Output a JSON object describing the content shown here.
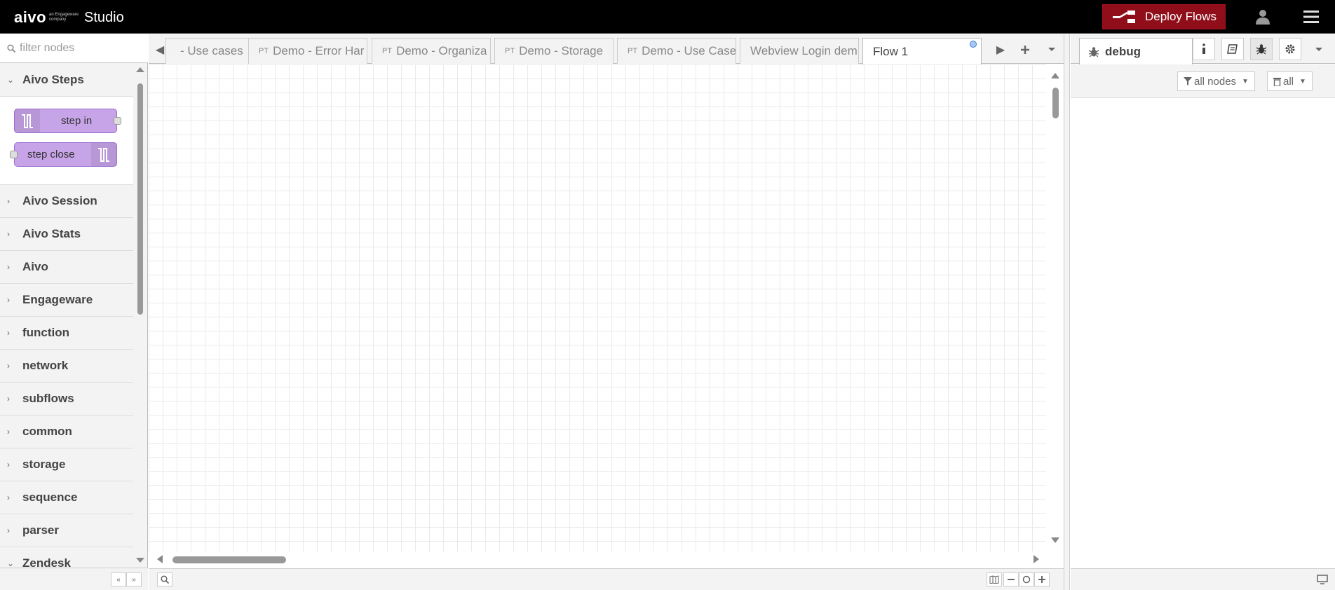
{
  "header": {
    "logo_text": "aivo",
    "logo_tagline": "an Engageware company",
    "app_name": "Studio",
    "deploy_label": "Deploy Flows",
    "icons": [
      "deploy-icon",
      "user-icon",
      "menu-icon"
    ]
  },
  "palette": {
    "filter_placeholder": "filter nodes",
    "open_category": {
      "label": "Aivo Steps",
      "nodes": [
        {
          "label": "step in",
          "icon": "step-icon"
        },
        {
          "label": "step close",
          "icon": "step-icon"
        }
      ]
    },
    "categories": [
      "Aivo Session",
      "Aivo Stats",
      "Aivo",
      "Engageware",
      "function",
      "network",
      "subflows",
      "common",
      "storage",
      "sequence",
      "parser"
    ],
    "last_category": "Zendesk",
    "node_color": "#c7a4e8"
  },
  "workspace": {
    "tabs": [
      {
        "prefix": "",
        "label": "- Use cases"
      },
      {
        "prefix": "PT",
        "label": "Demo - Error Har"
      },
      {
        "prefix": "PT",
        "label": "Demo - Organiza"
      },
      {
        "prefix": "PT",
        "label": "Demo - Storage"
      },
      {
        "prefix": "PT",
        "label": "Demo - Use Case"
      },
      {
        "prefix": "",
        "label": "Webview Login dem"
      },
      {
        "prefix": "",
        "label": "Flow 1"
      }
    ],
    "active_tab": "Flow 1",
    "tab_controls": [
      "scroll-left-icon",
      "scroll-right-icon",
      "add-icon",
      "tab-menu-icon"
    ],
    "footer_icons": [
      "search-icon",
      "navigator-icon",
      "zoom-out-icon",
      "zoom-reset-icon",
      "zoom-in-icon"
    ]
  },
  "sidebar": {
    "active_tab": "debug",
    "tab_buttons": [
      "info-icon",
      "help-icon",
      "debug-icon",
      "config-icon"
    ],
    "filter_label": "all nodes",
    "clear_label": "all"
  },
  "colors": {
    "header_bg": "#000000",
    "deploy_bg": "#8f0e1a",
    "accent_dot": "#3a7bd5"
  }
}
